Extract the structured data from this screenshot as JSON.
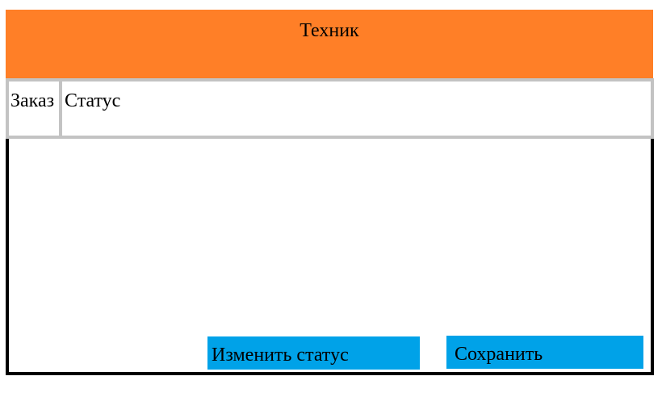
{
  "header": {
    "title": "Техник"
  },
  "table": {
    "columns": [
      "Заказ",
      "Статус"
    ]
  },
  "buttons": {
    "change_status": "Изменить статус",
    "save": "Сохранить"
  },
  "colors": {
    "header": "#ff7f27",
    "button": "#00a2e8",
    "grid": "#c3c3c3"
  }
}
